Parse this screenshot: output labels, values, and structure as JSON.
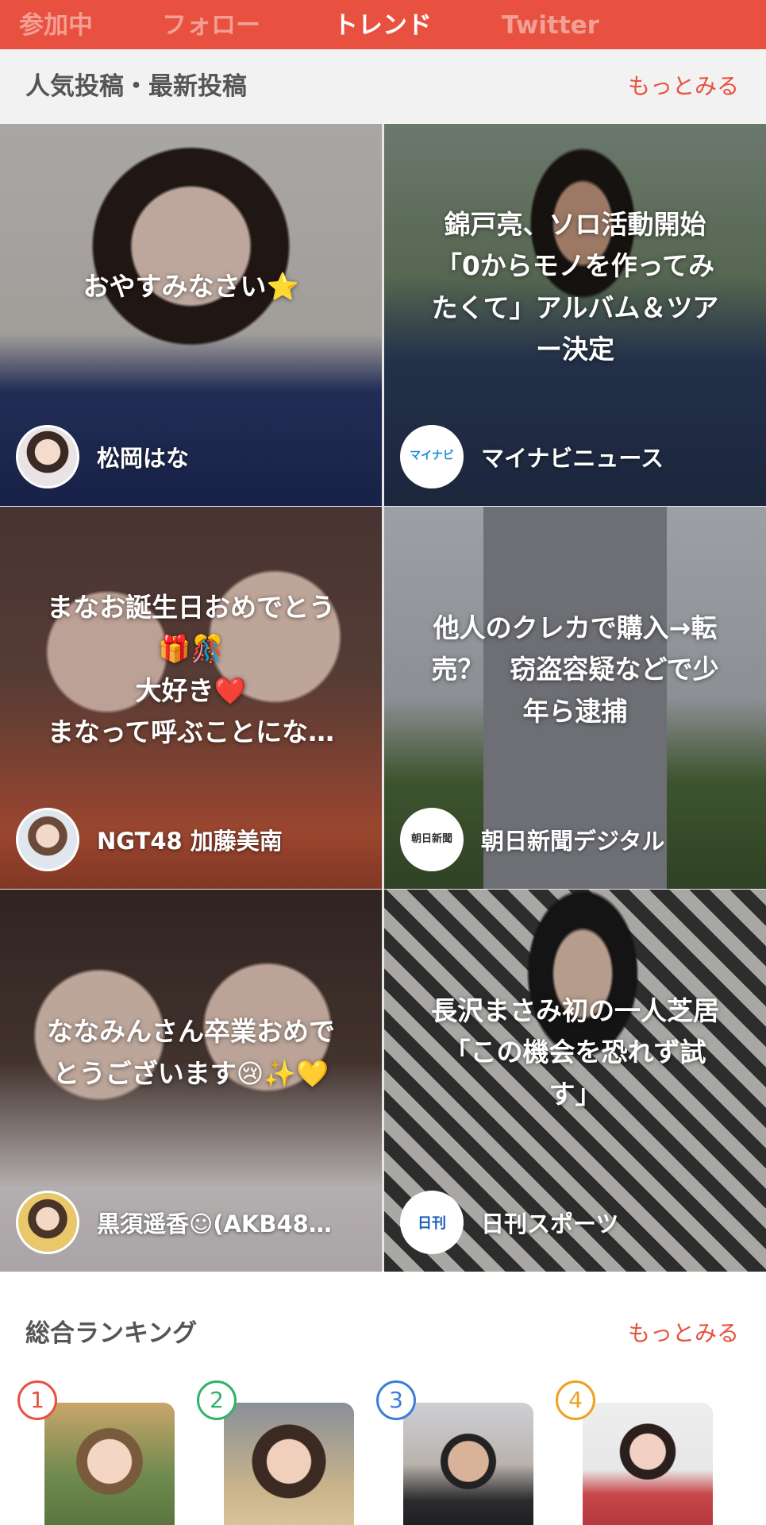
{
  "tabs": [
    {
      "label": "参加中",
      "active": false
    },
    {
      "label": "フォロー",
      "active": false
    },
    {
      "label": "トレンド",
      "active": true
    },
    {
      "label": "Twitter",
      "active": false
    }
  ],
  "popular": {
    "title": "人気投稿・最新投稿",
    "more_label": "もっとみる",
    "posts": [
      {
        "caption": "おやすみなさい⭐",
        "author": "松岡はな",
        "avatar_icon": "user-photo-icon"
      },
      {
        "caption": "錦戸亮、ソロ活動開始\n「0からモノを作ってみ\nたくて」アルバム＆ツア\nー決定",
        "author": "マイナビニュース",
        "avatar_icon": "mynavi-news-logo",
        "avatar_text": "マイナビ"
      },
      {
        "caption": "まなお誕生日おめでとう\n🎁🎊\n大好き❤️\nまなって呼ぶことにな…",
        "author": "NGT48 加藤美南",
        "avatar_icon": "user-photo-icon"
      },
      {
        "caption": "他人のクレカで購入→転\n売？　窃盗容疑などで少\n年ら逮捕",
        "author": "朝日新聞デジタル",
        "avatar_icon": "asahi-digital-logo",
        "avatar_text": "朝日新聞"
      },
      {
        "caption": "ななみんさん卒業おめで\nとうございます😢✨💛",
        "author": "黒須遥香☺(AKB48…",
        "avatar_icon": "user-photo-icon"
      },
      {
        "caption": "長沢まさみ初の一人芝居\n「この機会を恐れず試\nす」",
        "author": "日刊スポーツ",
        "avatar_icon": "nikkan-sports-logo",
        "avatar_text": "日刊"
      }
    ]
  },
  "ranking": {
    "title": "総合ランキング",
    "more_label": "もっとみる",
    "items": [
      {
        "rank": "1",
        "color": "#e8503f"
      },
      {
        "rank": "2",
        "color": "#2fb36a"
      },
      {
        "rank": "3",
        "color": "#3b7dd8"
      },
      {
        "rank": "4",
        "color": "#f0a020"
      }
    ]
  },
  "colors": {
    "accent": "#e8503f"
  }
}
